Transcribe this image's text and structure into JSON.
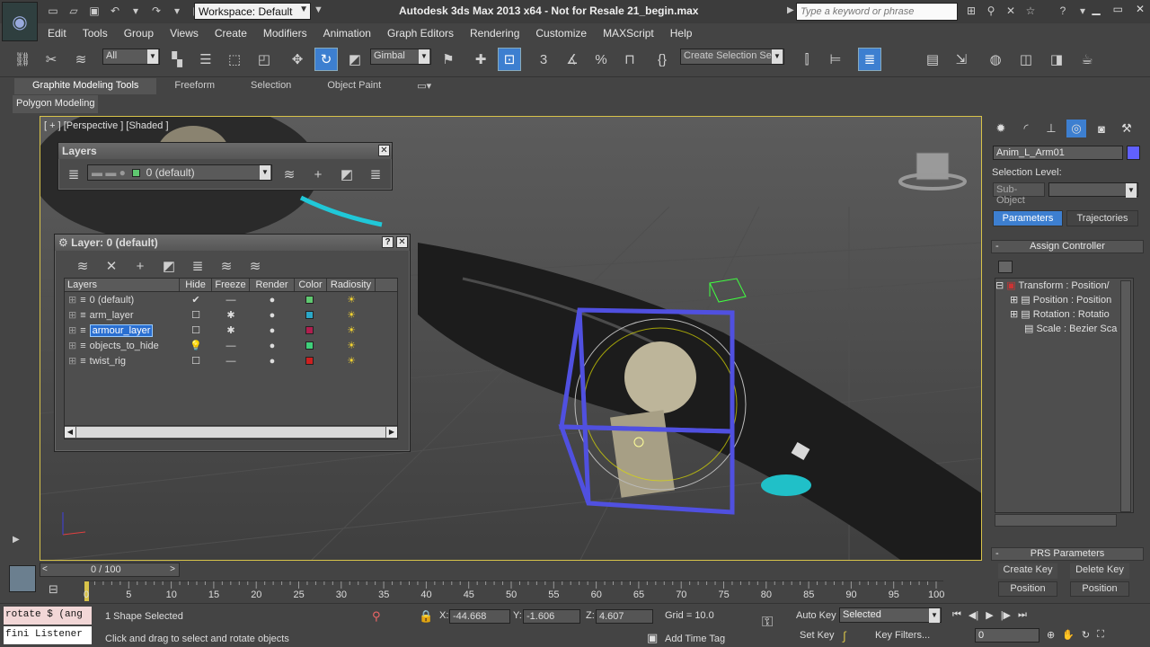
{
  "titlebar": {
    "workspace_label": "Workspace: Default",
    "title": "Autodesk 3ds Max  2013 x64   -  Not for Resale    21_begin.max",
    "search_placeholder": "Type a keyword or phrase"
  },
  "menu": [
    "Edit",
    "Tools",
    "Group",
    "Views",
    "Create",
    "Modifiers",
    "Animation",
    "Graph Editors",
    "Rendering",
    "Customize",
    "MAXScript",
    "Help"
  ],
  "toolbar": {
    "selection_filter": "All",
    "ref_coord": "Gimbal",
    "selection_set": "Create Selection Se"
  },
  "ribbon": {
    "tabs": [
      "Graphite Modeling Tools",
      "Freeform",
      "Selection",
      "Object Paint"
    ],
    "sub_panel": "Polygon Modeling"
  },
  "viewport": {
    "label": "[ + ] [Perspective ] [Shaded ]"
  },
  "layers_toolbar": {
    "title": "Layers",
    "current_layer": "0 (default)",
    "current_color": "#5fc870"
  },
  "layer_dialog": {
    "title": "Layer: 0 (default)",
    "columns": [
      "Layers",
      "Hide",
      "Freeze",
      "Render",
      "Color",
      "Radiosity"
    ],
    "rows": [
      {
        "name": "0 (default)",
        "color": "#5fc870",
        "current": true
      },
      {
        "name": "arm_layer",
        "color": "#2ba7c7",
        "current": false
      },
      {
        "name": "armour_layer",
        "color": "#b01e4e",
        "current": false,
        "selected": true
      },
      {
        "name": "objects_to_hide",
        "color": "#3fd07a",
        "current": false
      },
      {
        "name": "twist_rig",
        "color": "#cc2020",
        "current": false
      }
    ]
  },
  "command_panel": {
    "object_name": "Anim_L_Arm01",
    "object_color": "#6060ff",
    "selection_level_label": "Selection Level:",
    "sub_object_label": "Sub-Object",
    "tab_parameters": "Parameters",
    "tab_trajectories": "Trajectories",
    "rollout_assign": "Assign Controller",
    "tree": [
      "Transform : Position/",
      "Position : Position",
      "Rotation : Rotatio",
      "Scale : Bezier Sca"
    ],
    "rollout_prs": "PRS Parameters",
    "create_key": "Create Key",
    "delete_key": "Delete Key",
    "position_create": "Position",
    "position_delete": "Position"
  },
  "timeline": {
    "frame_label": "0 / 100",
    "ticks": [
      "0",
      "5",
      "10",
      "15",
      "20",
      "25",
      "30",
      "35",
      "40",
      "45",
      "50",
      "55",
      "60",
      "65",
      "70",
      "75",
      "80",
      "85",
      "90",
      "95",
      "100"
    ]
  },
  "status": {
    "listener_top": "rotate $ (ang",
    "listener_bottom": "fini Listener",
    "selected_text": "1 Shape Selected",
    "prompt": "Click and drag to select and rotate objects",
    "x_label": "X:",
    "x_value": "-44.668",
    "y_label": "Y:",
    "y_value": "-1.606",
    "z_label": "Z:",
    "z_value": "4.607",
    "grid": "Grid = 10.0",
    "add_time_tag": "Add Time Tag",
    "auto_key": "Auto Key",
    "set_key": "Set Key",
    "selected_dd": "Selected",
    "key_filters": "Key Filters...",
    "frame_value": "0"
  }
}
